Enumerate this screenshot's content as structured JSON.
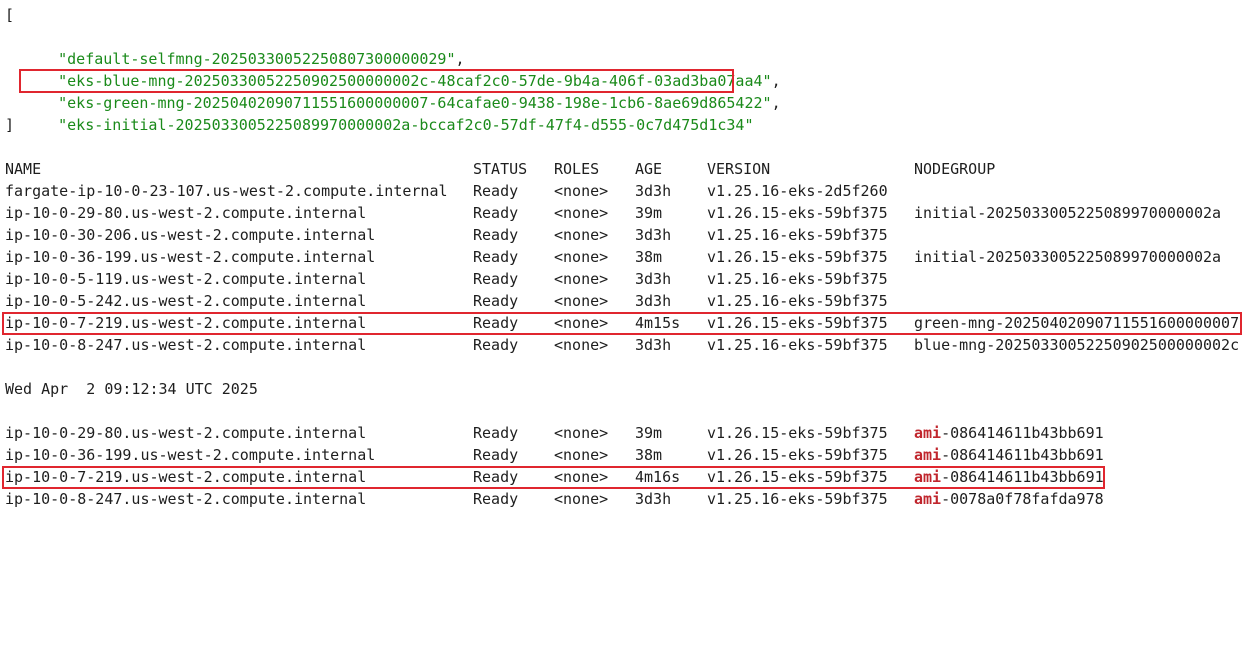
{
  "json_output": {
    "open_bracket": "[",
    "close_bracket": "]",
    "items": [
      {
        "text": "\"default-selfmng-20250330052250807300000029\"",
        "suffix": ","
      },
      {
        "text": "\"eks-blue-mng-20250330052250902500000002c-48caf2c0-57de-9b4a-406f-03ad3ba07aa4\"",
        "suffix": ","
      },
      {
        "text": "\"eks-green-mng-20250402090711551600000007-64cafae0-9438-198e-1cb6-8ae69d865422\"",
        "suffix": ","
      },
      {
        "text": "\"eks-initial-2025033005225089970000002a-bccaf2c0-57df-47f4-d555-0c7d475d1c34\"",
        "suffix": ""
      }
    ]
  },
  "nodes_table": {
    "headers": [
      "NAME",
      "STATUS",
      "ROLES",
      "AGE",
      "VERSION",
      "NODEGROUP"
    ],
    "rows": [
      [
        "fargate-ip-10-0-23-107.us-west-2.compute.internal",
        "Ready",
        "<none>",
        "3d3h",
        "v1.25.16-eks-2d5f260",
        ""
      ],
      [
        "ip-10-0-29-80.us-west-2.compute.internal",
        "Ready",
        "<none>",
        "39m",
        "v1.26.15-eks-59bf375",
        "initial-2025033005225089970000002a"
      ],
      [
        "ip-10-0-30-206.us-west-2.compute.internal",
        "Ready",
        "<none>",
        "3d3h",
        "v1.25.16-eks-59bf375",
        ""
      ],
      [
        "ip-10-0-36-199.us-west-2.compute.internal",
        "Ready",
        "<none>",
        "38m",
        "v1.26.15-eks-59bf375",
        "initial-2025033005225089970000002a"
      ],
      [
        "ip-10-0-5-119.us-west-2.compute.internal",
        "Ready",
        "<none>",
        "3d3h",
        "v1.25.16-eks-59bf375",
        ""
      ],
      [
        "ip-10-0-5-242.us-west-2.compute.internal",
        "Ready",
        "<none>",
        "3d3h",
        "v1.25.16-eks-59bf375",
        ""
      ],
      [
        "ip-10-0-7-219.us-west-2.compute.internal",
        "Ready",
        "<none>",
        "4m15s",
        "v1.26.15-eks-59bf375",
        "green-mng-20250402090711551600000007"
      ],
      [
        "ip-10-0-8-247.us-west-2.compute.internal",
        "Ready",
        "<none>",
        "3d3h",
        "v1.25.16-eks-59bf375",
        "blue-mng-20250330052250902500000002c"
      ]
    ]
  },
  "timestamp": "Wed Apr  2 09:12:34 UTC 2025",
  "ami_table": {
    "rows": [
      [
        "ip-10-0-29-80.us-west-2.compute.internal",
        "Ready",
        "<none>",
        "39m",
        "v1.26.15-eks-59bf375",
        "ami",
        "-086414611b43bb691"
      ],
      [
        "ip-10-0-36-199.us-west-2.compute.internal",
        "Ready",
        "<none>",
        "38m",
        "v1.26.15-eks-59bf375",
        "ami",
        "-086414611b43bb691"
      ],
      [
        "ip-10-0-7-219.us-west-2.compute.internal",
        "Ready",
        "<none>",
        "4m16s",
        "v1.26.15-eks-59bf375",
        "ami",
        "-086414611b43bb691"
      ],
      [
        "ip-10-0-8-247.us-west-2.compute.internal",
        "Ready",
        "<none>",
        "3d3h",
        "v1.25.16-eks-59bf375",
        "ami",
        "-0078a0f78fafda978"
      ]
    ]
  },
  "colors": {
    "string_green": "#1a8a1a",
    "ami_red": "#c0262d",
    "highlight_red": "#e0262f",
    "text": "#1e1e1e"
  }
}
